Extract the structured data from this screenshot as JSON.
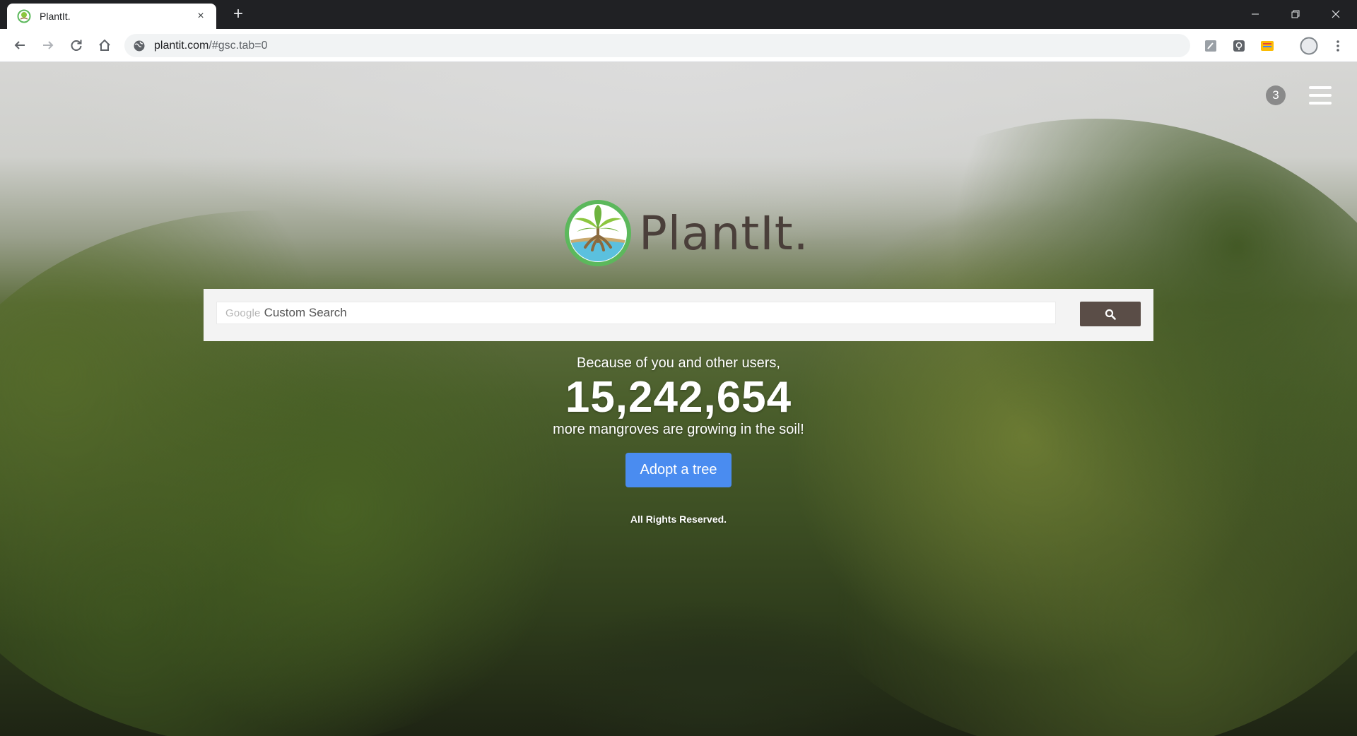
{
  "browser": {
    "tab_title": "PlantIt.",
    "tab_close": "×",
    "new_tab": "+",
    "url_host": "plantit.com",
    "url_path": "/#gsc.tab=0"
  },
  "page": {
    "notification_count": "3",
    "logo_text": "PlantIt.",
    "search": {
      "brand": "Google",
      "placeholder": "Custom Search"
    },
    "tagline_top": "Because of you and other users,",
    "counter": "15,242,654",
    "tagline_bottom": "more mangroves are growing in the soil!",
    "adopt_button": "Adopt a tree",
    "footer": "All Rights Reserved."
  },
  "colors": {
    "accent_button": "#4a8cf0",
    "search_button": "#5a4d47",
    "logo_text": "#4a3f3a",
    "logo_ring": "#5cb85c"
  },
  "icons": [
    "back-icon",
    "forward-icon",
    "reload-icon",
    "home-icon",
    "site-info-icon",
    "extension-icon",
    "profile-icon",
    "more-icon",
    "search-icon",
    "hamburger-menu-icon"
  ]
}
